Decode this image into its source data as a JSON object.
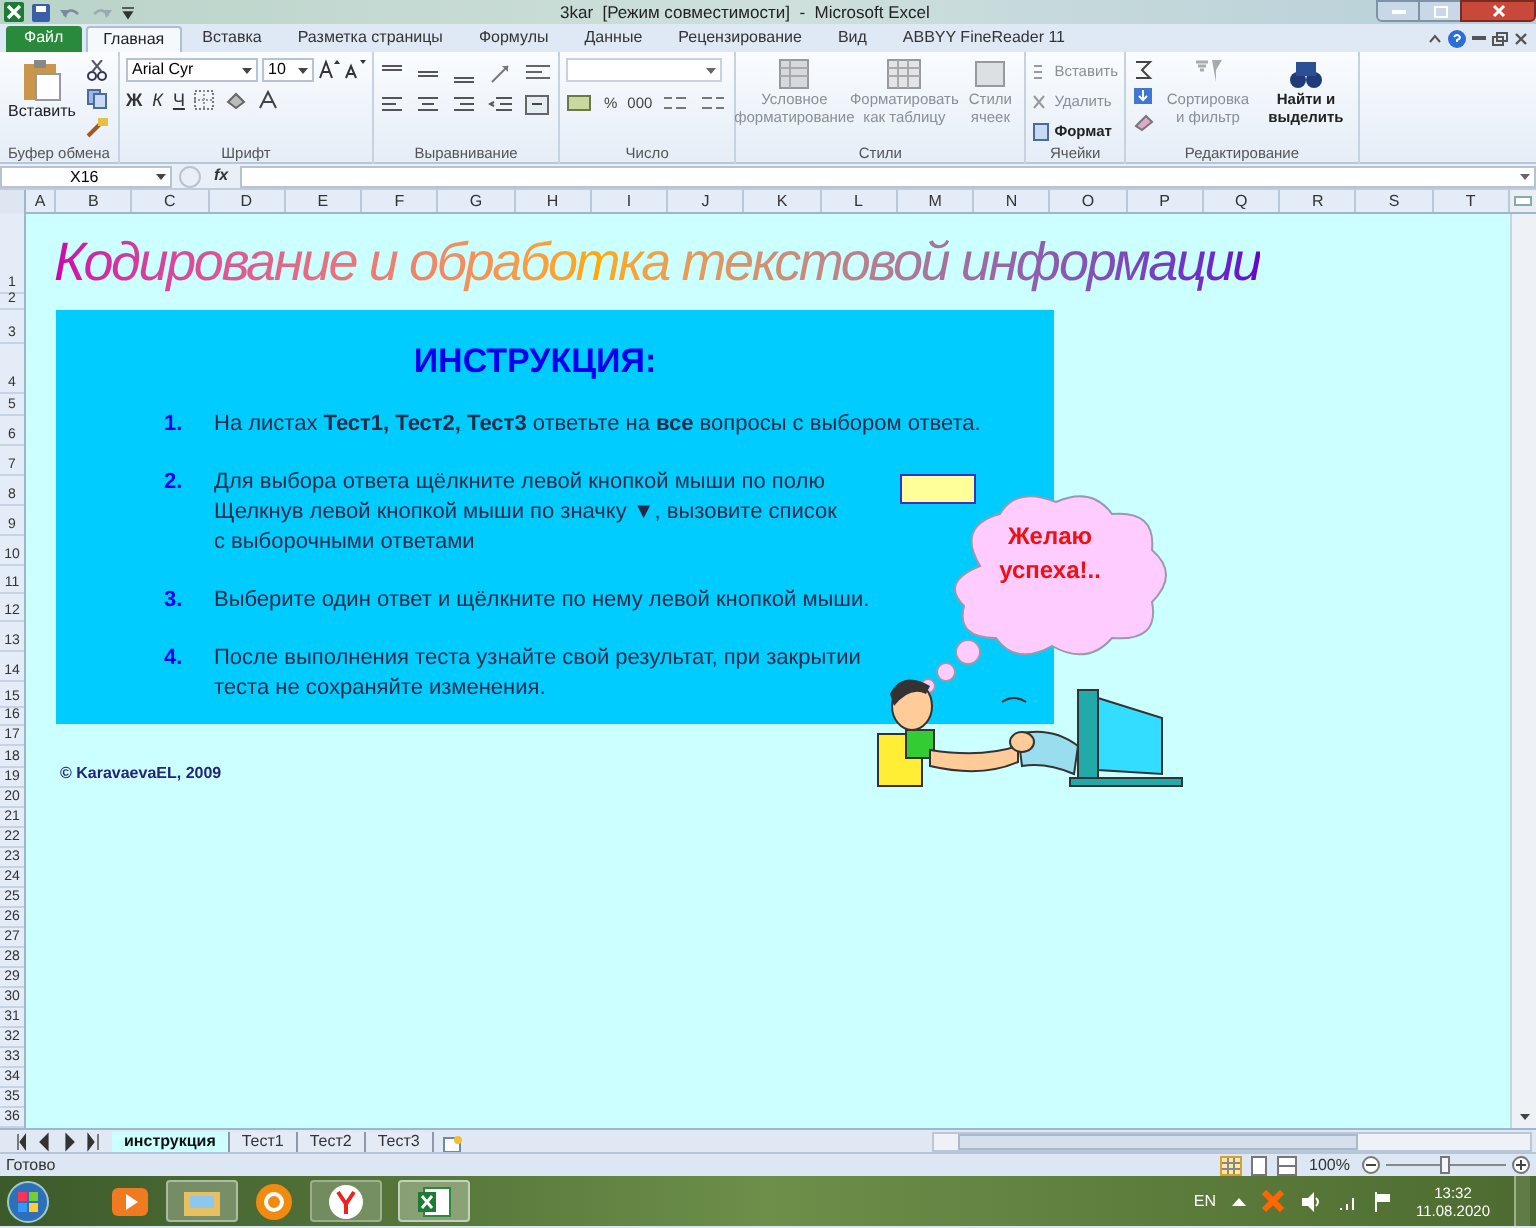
{
  "window": {
    "title": "3kar  [Режим совместимости]  -  Microsoft Excel"
  },
  "ribbon_tabs": [
    {
      "label": "Файл",
      "kind": "file",
      "selected": false
    },
    {
      "label": "Главная",
      "kind": "tab",
      "selected": true
    },
    {
      "label": "Вставка",
      "kind": "tab",
      "selected": false
    },
    {
      "label": "Разметка страницы",
      "kind": "tab",
      "selected": false
    },
    {
      "label": "Формулы",
      "kind": "tab",
      "selected": false
    },
    {
      "label": "Данные",
      "kind": "tab",
      "selected": false
    },
    {
      "label": "Рецензирование",
      "kind": "tab",
      "selected": false
    },
    {
      "label": "Вид",
      "kind": "tab",
      "selected": false
    },
    {
      "label": "ABBYY FineReader 11",
      "kind": "tab",
      "selected": false
    }
  ],
  "ribbon": {
    "clipboard": {
      "paste": "Вставить",
      "label": "Буфер обмена"
    },
    "font": {
      "name": "Arial Cyr",
      "size": "10",
      "bold": "Ж",
      "italic": "К",
      "underline": "Ч",
      "label": "Шрифт"
    },
    "alignment": {
      "label": "Выравнивание"
    },
    "number": {
      "percent": "%",
      "thousands": "000",
      "label": "Число"
    },
    "styles": {
      "label": "Стили",
      "buttons": [
        {
          "label": "Условное форматирование",
          "disabled": true
        },
        {
          "label": "Форматировать как таблицу",
          "disabled": true
        },
        {
          "label": "Стили ячеек",
          "disabled": true
        }
      ]
    },
    "cells": {
      "label": "Ячейки",
      "buttons": [
        {
          "label": "Вставить",
          "disabled": true
        },
        {
          "label": "Удалить",
          "disabled": true
        },
        {
          "label": "Формат",
          "disabled": false
        }
      ]
    },
    "editing": {
      "label": "Редактирование",
      "buttons": [
        {
          "label": "Сортировка и фильтр",
          "disabled": true
        },
        {
          "label": "Найти и выделить",
          "disabled": false
        }
      ]
    }
  },
  "formula_bar": {
    "name_box": "X16",
    "fx": "fx"
  },
  "columns": [
    "A",
    "B",
    "C",
    "D",
    "E",
    "F",
    "G",
    "H",
    "I",
    "J",
    "K",
    "L",
    "M",
    "N",
    "O",
    "P",
    "Q",
    "R",
    "S",
    "T"
  ],
  "rows": [
    "1",
    "2",
    "3",
    "4",
    "5",
    "6",
    "7",
    "8",
    "9",
    "10",
    "11",
    "12",
    "13",
    "14",
    "15",
    "16",
    "17",
    "18",
    "19",
    "20",
    "21",
    "22",
    "23",
    "24",
    "25",
    "26",
    "27",
    "28",
    "29",
    "30",
    "31",
    "32",
    "33",
    "34",
    "35",
    "36"
  ],
  "sheet": {
    "title": "Кодирование и обработка текстовой информации",
    "panel": {
      "heading": "ИНСТРУКЦИЯ:",
      "steps": [
        {
          "number": "1.",
          "text": "На листах **Тест1, Тест2, Тест3** ответьте на **все** вопросы с выбором ответа."
        },
        {
          "number": "2.",
          "text": "Для выбора ответа щёлкните левой кнопкой мыши по полю\nЩелкнув левой кнопкой мыши по значку ▼, вызовите список\nс выборочными ответами"
        },
        {
          "number": "3.",
          "text": "Выберите один ответ и щёлкните по нему левой кнопкой мыши."
        },
        {
          "number": "4.",
          "text": "После выполнения теста узнайте свой результат, при закрытии\nтеста не сохраняйте изменения."
        }
      ]
    },
    "bubble": "Желаю\nуспеха!..",
    "copyright": "© KaravaevaEL, 2009"
  },
  "sheet_tabs": [
    {
      "label": "инструкция",
      "selected": true
    },
    {
      "label": "Тест1",
      "selected": false
    },
    {
      "label": "Тест2",
      "selected": false
    },
    {
      "label": "Тест3",
      "selected": false
    }
  ],
  "status_bar": {
    "status": "Готово",
    "zoom": "100%",
    "zoom_slider": {
      "level": 0.5
    }
  },
  "taskbar": {
    "language": "EN",
    "time": "13:32",
    "date": "11.08.2020"
  }
}
